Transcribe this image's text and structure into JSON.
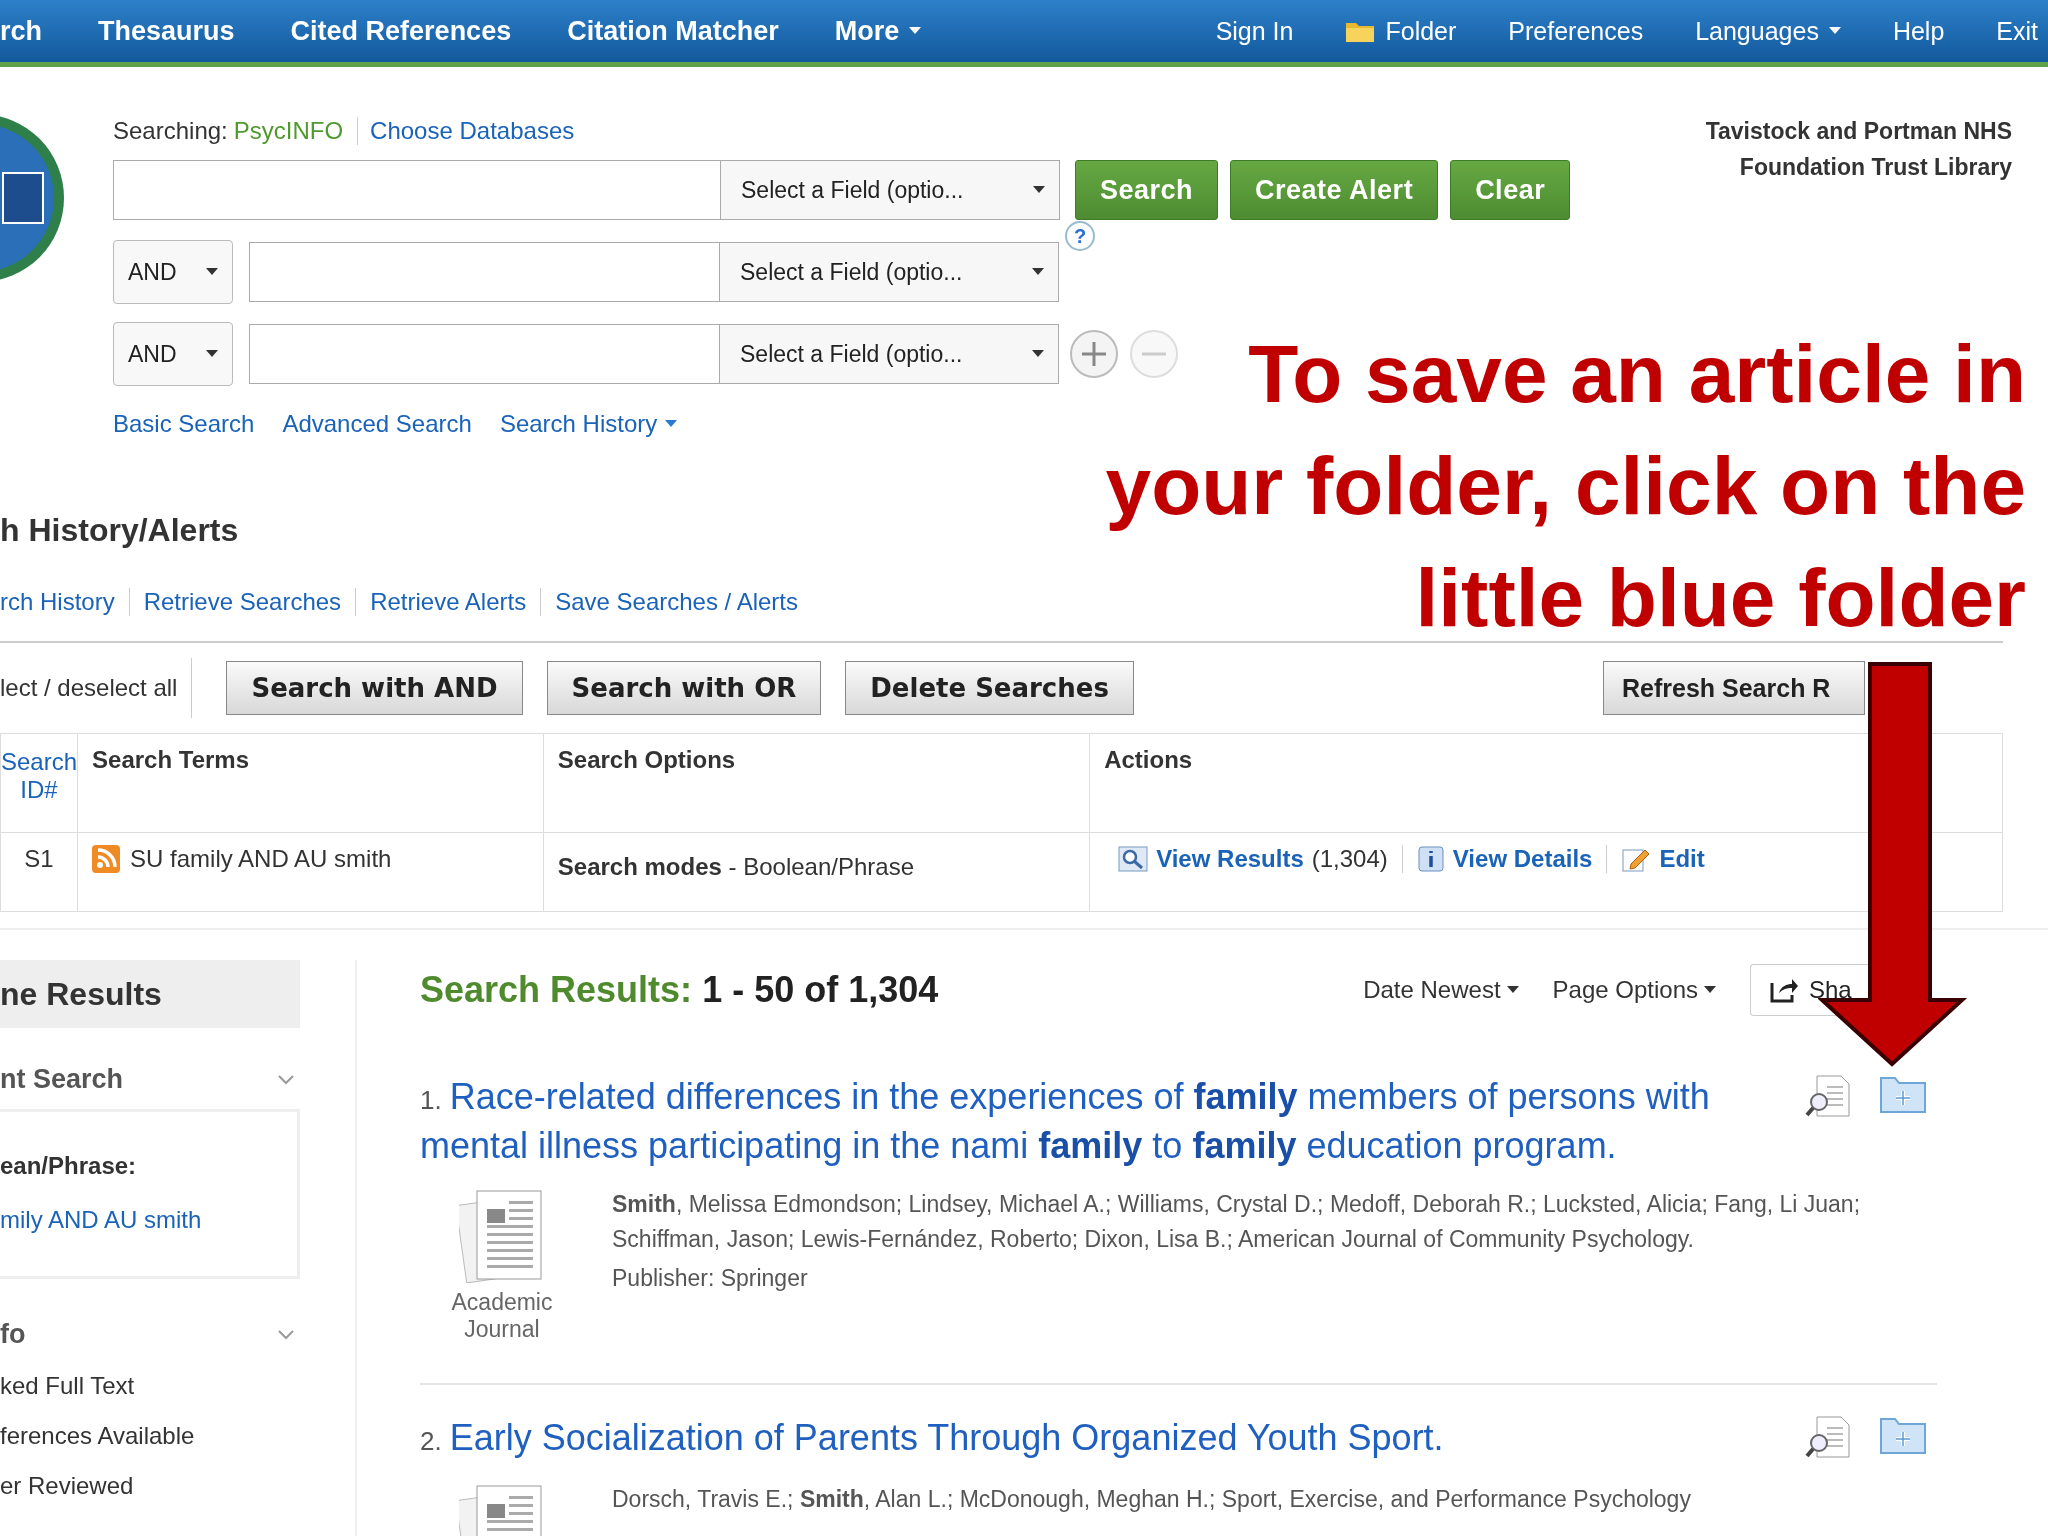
{
  "nav": {
    "left": [
      {
        "label": "rch",
        "kind": "link"
      },
      {
        "label": "Thesaurus",
        "kind": "link"
      },
      {
        "label": "Cited References",
        "kind": "link"
      },
      {
        "label": "Citation Matcher",
        "kind": "link"
      },
      {
        "label": "More",
        "kind": "menu"
      }
    ],
    "right": [
      {
        "label": "Sign In",
        "kind": "link"
      },
      {
        "label": "Folder",
        "kind": "folder"
      },
      {
        "label": "Preferences",
        "kind": "link"
      },
      {
        "label": "Languages",
        "kind": "menu"
      },
      {
        "label": "Help",
        "kind": "link"
      },
      {
        "label": "Exit",
        "kind": "link"
      }
    ]
  },
  "searching": {
    "label": "Searching:",
    "database": "PsycINFO",
    "choose": "Choose Databases"
  },
  "search_rows": [
    {
      "kind": "first",
      "field": "Select a Field (optio..."
    },
    {
      "kind": "operator",
      "operator": "AND",
      "field": "Select a Field (optio..."
    },
    {
      "kind": "operator",
      "operator": "AND",
      "field": "Select a Field (optio..."
    }
  ],
  "buttons": [
    "Search",
    "Create Alert",
    "Clear"
  ],
  "search_links": [
    {
      "label": "Basic Search",
      "kind": "link"
    },
    {
      "label": "Advanced Search",
      "kind": "link"
    },
    {
      "label": "Search History",
      "kind": "menu"
    }
  ],
  "library": "Tavistock and Portman NHS\nFoundation Trust Library",
  "history": {
    "heading": "h History/Alerts",
    "links": [
      "rch History",
      "Retrieve Searches",
      "Retrieve Alerts",
      "Save Searches / Alerts"
    ],
    "select_all": "lect / deselect all",
    "buttons": [
      "Search with AND",
      "Search with OR",
      "Delete Searches"
    ],
    "refresh": "Refresh Search R",
    "columns": [
      "Search ID#",
      "Search Terms",
      "Search Options",
      "Actions"
    ],
    "rows": [
      {
        "id": "S1",
        "terms": "SU family AND AU smith",
        "options": "**Search modes** - Boolean/Phrase",
        "actions": [
          {
            "kind": "results",
            "label": "View Results",
            "count": "(1,304)"
          },
          {
            "kind": "details",
            "label": "View Details"
          },
          {
            "kind": "edit",
            "label": "Edit"
          }
        ]
      }
    ]
  },
  "sidebar": {
    "title": "ne Results",
    "current": {
      "heading": "nt Search",
      "mode": "ean/Phrase:",
      "query": "mily AND AU smith"
    },
    "info": {
      "heading": "fo",
      "items": [
        "ked Full Text",
        "ferences Available",
        "er Reviewed"
      ]
    }
  },
  "results": {
    "label": "Search Results:",
    "range": "1 - 50 of 1,304",
    "sort": "Date Newest",
    "options": "Page Options",
    "share": "Sha",
    "items": [
      {
        "number": "1.",
        "title": "Race-related differences in the experiences of **family** members of persons with mental illness participating in the nami **family** to **family** education program.",
        "type": "Academic Journal",
        "authors": "**Smith**, Melissa Edmondson; Lindsey, Michael A.; Williams, Crystal D.; Medoff, Deborah R.; Lucksted, Alicia; Fang, Li Juan; Schiffman, Jason; Lewis-Fernández, Roberto; Dixon, Lisa B.; American Journal of Community Psychology.",
        "publisher": "Publisher: Springer"
      },
      {
        "number": "2.",
        "title": "Early Socialization of Parents Through Organized Youth Sport.",
        "authors": "Dorsch, Travis E.; **Smith**, Alan L.; McDonough, Meghan H.; Sport, Exercise, and Performance Psychology"
      }
    ]
  },
  "help": "?",
  "annotation": {
    "lines": [
      "To save an article in",
      "your folder, click on the",
      "little blue folder"
    ]
  }
}
